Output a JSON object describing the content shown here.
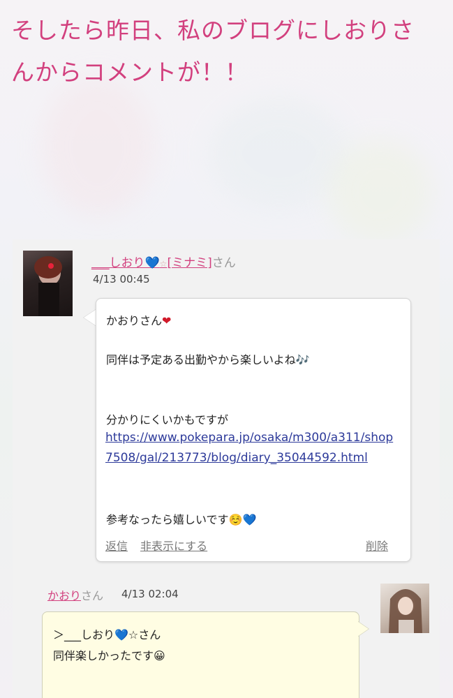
{
  "headline": {
    "line1": "そしたら昨日、私のブログにしおりさ",
    "line2": "んからコメントが！！"
  },
  "comment1": {
    "user_prefix": "___しおり",
    "user_heart": "💙",
    "user_star": "☆",
    "user_suffix": "[ミナミ]",
    "san": "さん",
    "date": "4/13 00:45",
    "greeting": "かおりさん",
    "greeting_heart": "❤",
    "line2": "同伴は予定ある出勤やから楽しいよね🎶",
    "line3": "分かりにくいかもですが",
    "link": "https://www.pokepara.jp/osaka/m300/a311/shop7508/gal/213773/blog/diary_35044592.html",
    "line4": "参考なったら嬉しいです☺️💙",
    "reply": "返信",
    "hide": "非表示にする",
    "delete": "削除"
  },
  "comment2": {
    "user": "かおり",
    "san": "さん",
    "date": "4/13 02:04",
    "line1": "＞___しおり💙☆さん",
    "line2": "同伴楽しかったです😀"
  },
  "colors": {
    "accent": "#d2407e",
    "link": "#2d3a9a",
    "panel": "#f2f2f2",
    "reply_bubble": "#fffde3"
  }
}
